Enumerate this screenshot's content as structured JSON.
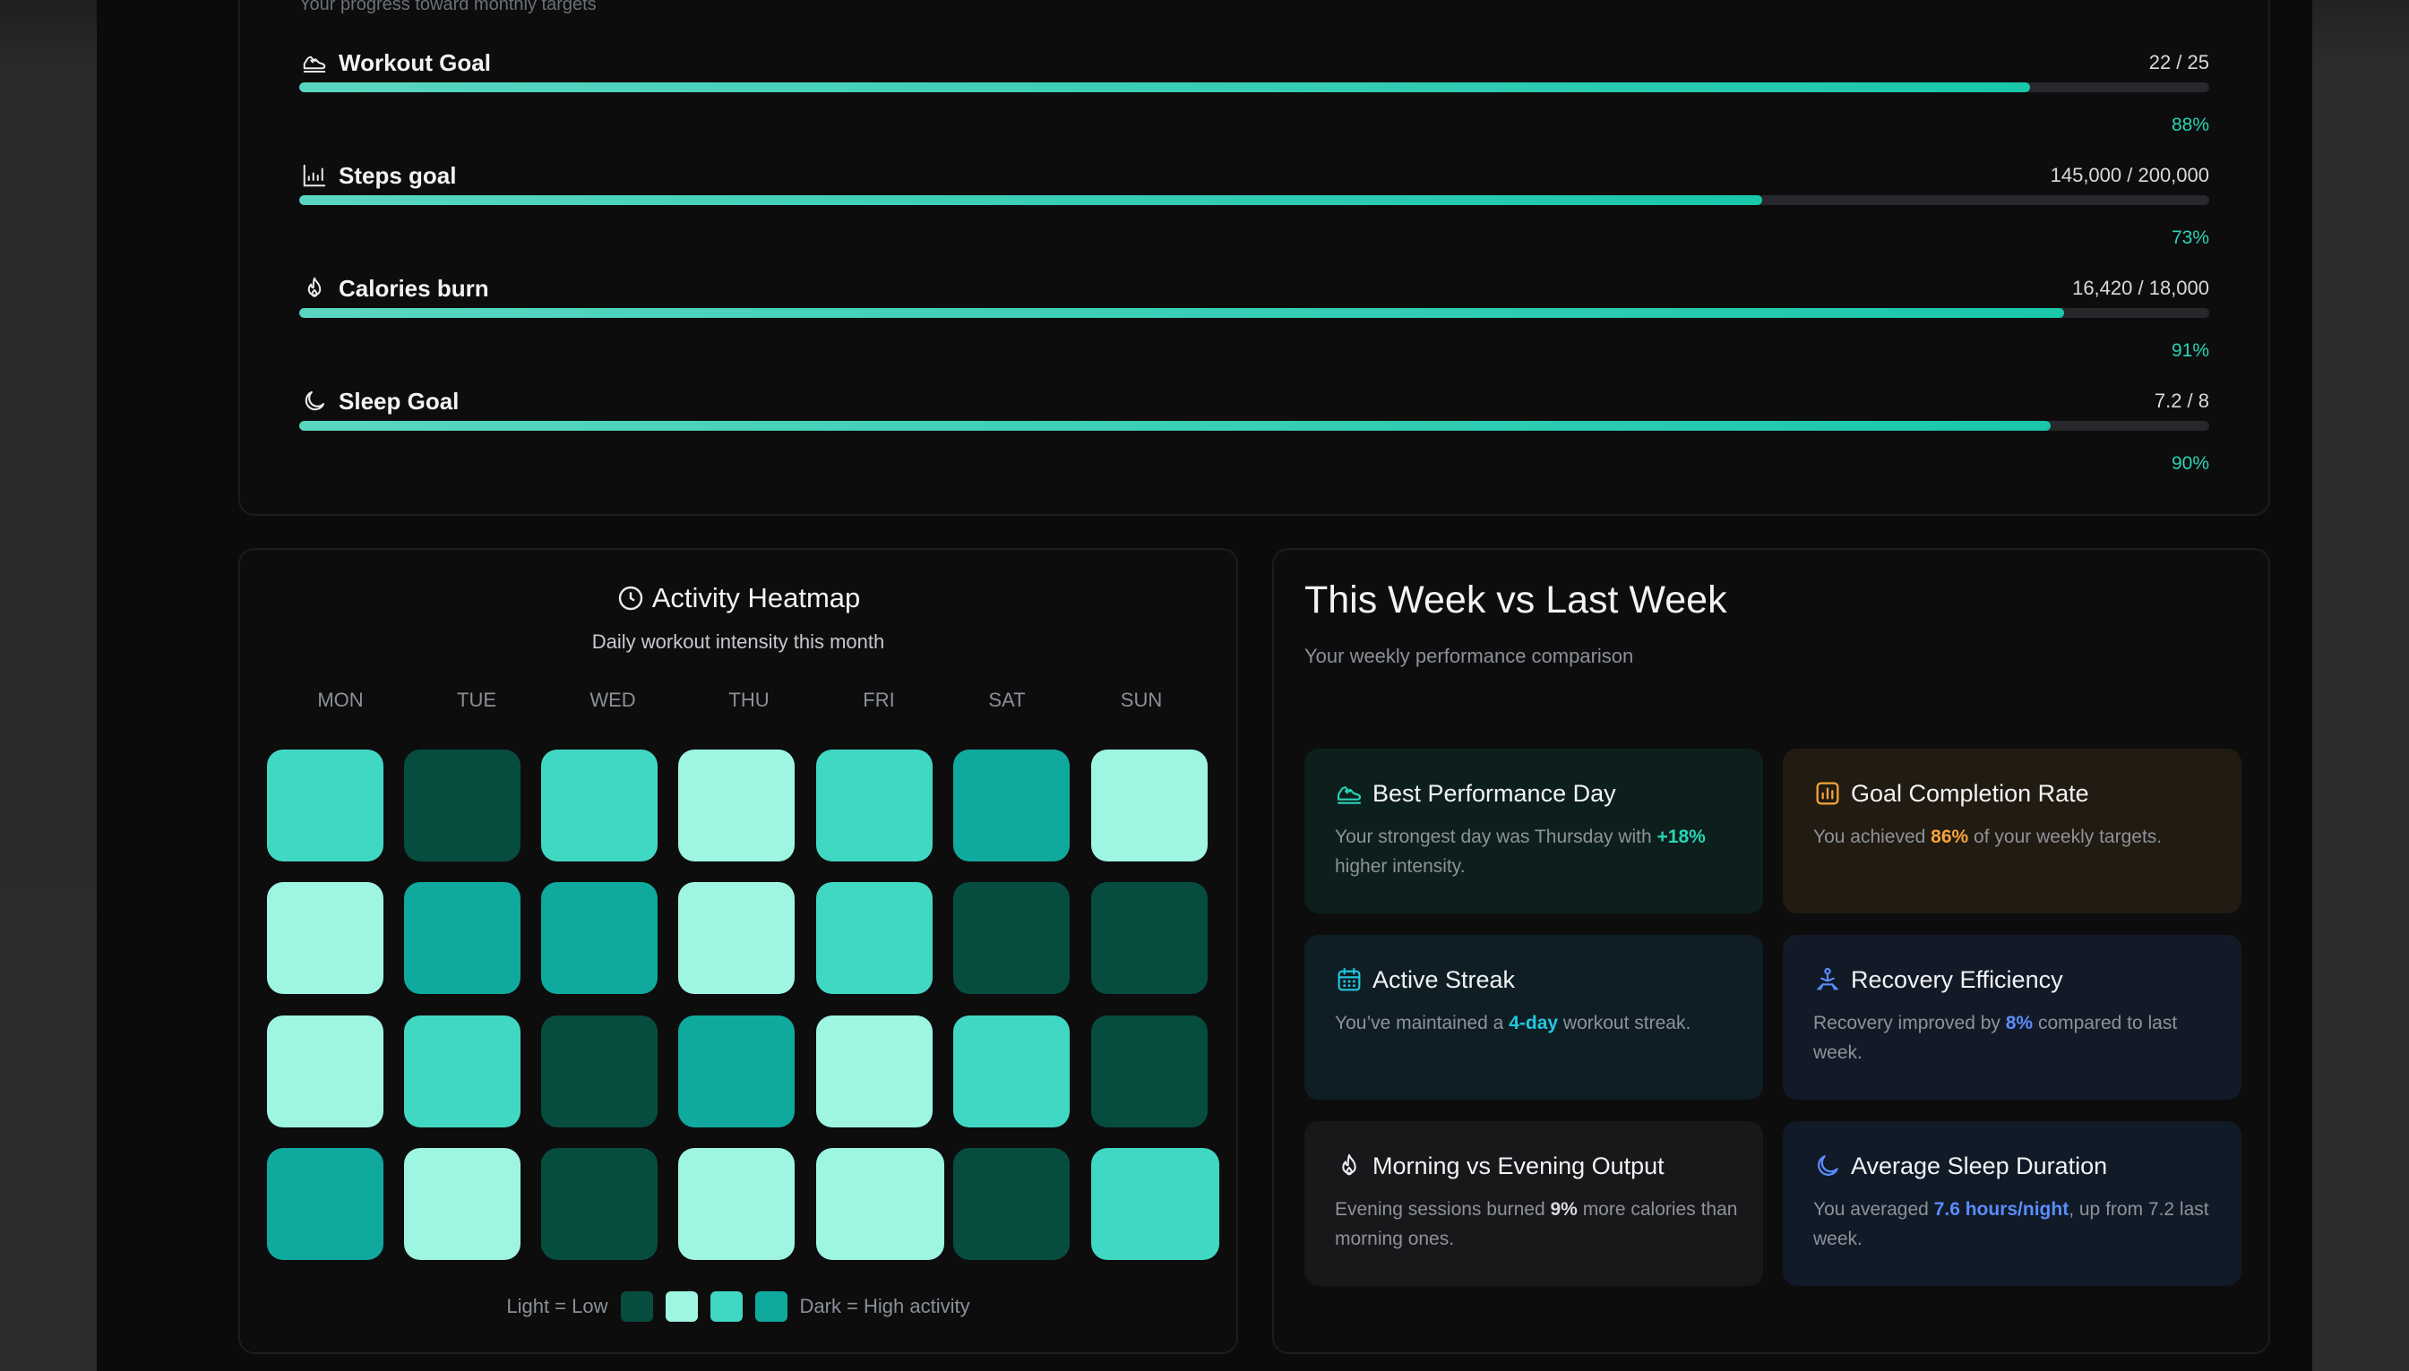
{
  "goals": {
    "subtitle": "Your progress toward monthly targets",
    "items": [
      {
        "label": "Workout Goal",
        "value": "22 / 25",
        "percent_label": "88%",
        "progress": 0.906,
        "icon": "shoe-icon"
      },
      {
        "label": "Steps goal",
        "value": "145,000 / 200,000",
        "percent_label": "73%",
        "progress": 0.766,
        "icon": "steps-chart-icon"
      },
      {
        "label": "Calories burn",
        "value": "16,420 / 18,000",
        "percent_label": "91%",
        "progress": 0.924,
        "icon": "flame-icon"
      },
      {
        "label": "Sleep Goal",
        "value": "7.2 / 8",
        "percent_label": "90%",
        "progress": 0.917,
        "icon": "moon-icon"
      }
    ]
  },
  "heatmap": {
    "title": "Activity Heatmap",
    "subtitle": "Daily workout intensity this month",
    "days": [
      "MON",
      "TUE",
      "WED",
      "THU",
      "FRI",
      "SAT",
      "SUN"
    ],
    "levels": [
      [
        2,
        0,
        2,
        1,
        2,
        3,
        1
      ],
      [
        1,
        3,
        3,
        1,
        2,
        0,
        0
      ],
      [
        1,
        2,
        0,
        3,
        1,
        2,
        0
      ],
      [
        3,
        1,
        0,
        1,
        1,
        0,
        2
      ]
    ],
    "level_colors": [
      "#064d3f",
      "#9df5e2",
      "#41d8c3",
      "#10a99d"
    ],
    "legend": {
      "low_label": "Light = Low",
      "high_label": "Dark = High activity"
    }
  },
  "comparison": {
    "title": "This Week vs Last Week",
    "subtitle": "Your weekly performance comparison",
    "tiles": [
      {
        "title": "Best Performance Day",
        "pre": "Your strongest day was Thursday with ",
        "highlight": "+18%",
        "post": " higher intensity.",
        "accent": "#2ad4b6",
        "icon": "shoe-icon"
      },
      {
        "title": "Goal Completion Rate",
        "pre": "You achieved ",
        "highlight": "86%",
        "post": " of your weekly targets.",
        "accent": "#f4a53a",
        "icon": "bar-chart-icon"
      },
      {
        "title": "Active Streak",
        "pre": "You’ve maintained a ",
        "highlight": "4-day",
        "post": " workout streak.",
        "accent": "#22c7e0",
        "icon": "calendar-icon"
      },
      {
        "title": "Recovery Efficiency",
        "pre": "Recovery improved by ",
        "highlight": "8%",
        "post": " compared to last week.",
        "accent": "#5b8cff",
        "icon": "meditation-icon"
      },
      {
        "title": "Morning vs Evening Output",
        "pre": "Evening sessions burned ",
        "highlight": "9%",
        "post": " more calories than morning ones.",
        "accent": "#e8eaed",
        "icon": "flame-icon"
      },
      {
        "title": "Average Sleep Duration",
        "pre": "You averaged ",
        "highlight": "7.6 hours/night",
        "post": ", up from 7.2 last week.",
        "accent": "#5b8cff",
        "icon": "moon-icon"
      }
    ]
  }
}
